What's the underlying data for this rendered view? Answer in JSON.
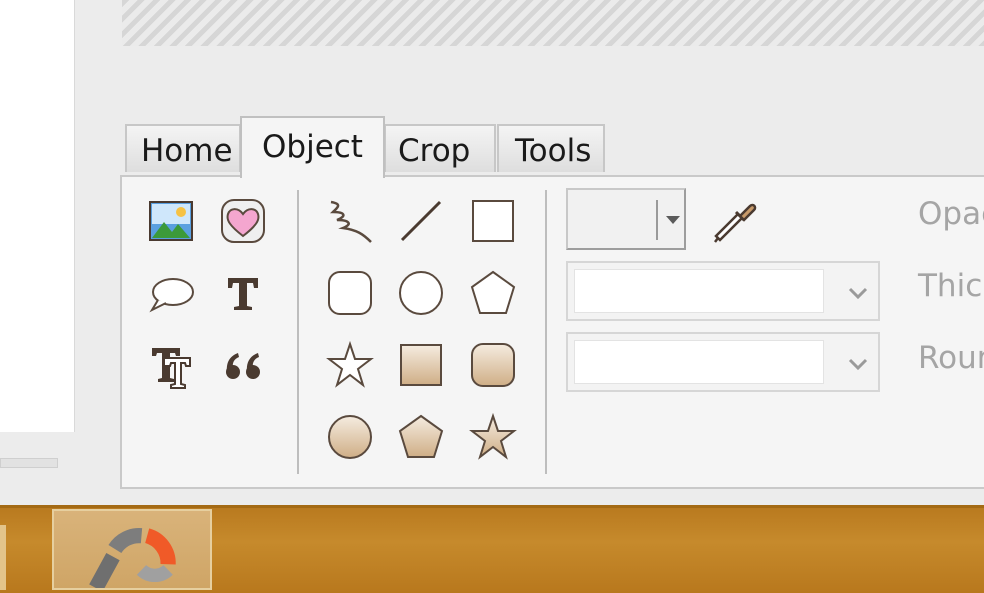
{
  "tabs": [
    {
      "label": "Home",
      "active": false
    },
    {
      "label": "Object",
      "active": true
    },
    {
      "label": "Crop",
      "active": false
    },
    {
      "label": "Tools",
      "active": false
    }
  ],
  "tool_icons": {
    "group1": [
      "picture-icon",
      "heart-sticker-icon",
      "speech-bubble-icon",
      "text-icon",
      "outlined-text-icon",
      "quote-icon"
    ],
    "group2": [
      "freehand-icon",
      "line-icon",
      "rectangle-icon",
      "rounded-rectangle-icon",
      "ellipse-icon",
      "pentagon-icon",
      "star-icon",
      "filled-rectangle-icon",
      "filled-rounded-rectangle-icon",
      "filled-ellipse-icon",
      "filled-pentagon-icon",
      "filled-star-icon"
    ]
  },
  "properties": {
    "color_picker_value": "",
    "thickness_value": "",
    "roundness_value": "",
    "labels": {
      "opacity": "Opac",
      "thickness": "Thic",
      "roundness": "Roun"
    }
  },
  "colors": {
    "accent_fill": "#d8bd9b",
    "shape_stroke": "#5a4a3e",
    "taskbar": "#c68a2c",
    "taskbar_app_icon_accent": "#f05a28"
  },
  "taskbar": {
    "pinned_app_icon": "app-logo-icon"
  }
}
